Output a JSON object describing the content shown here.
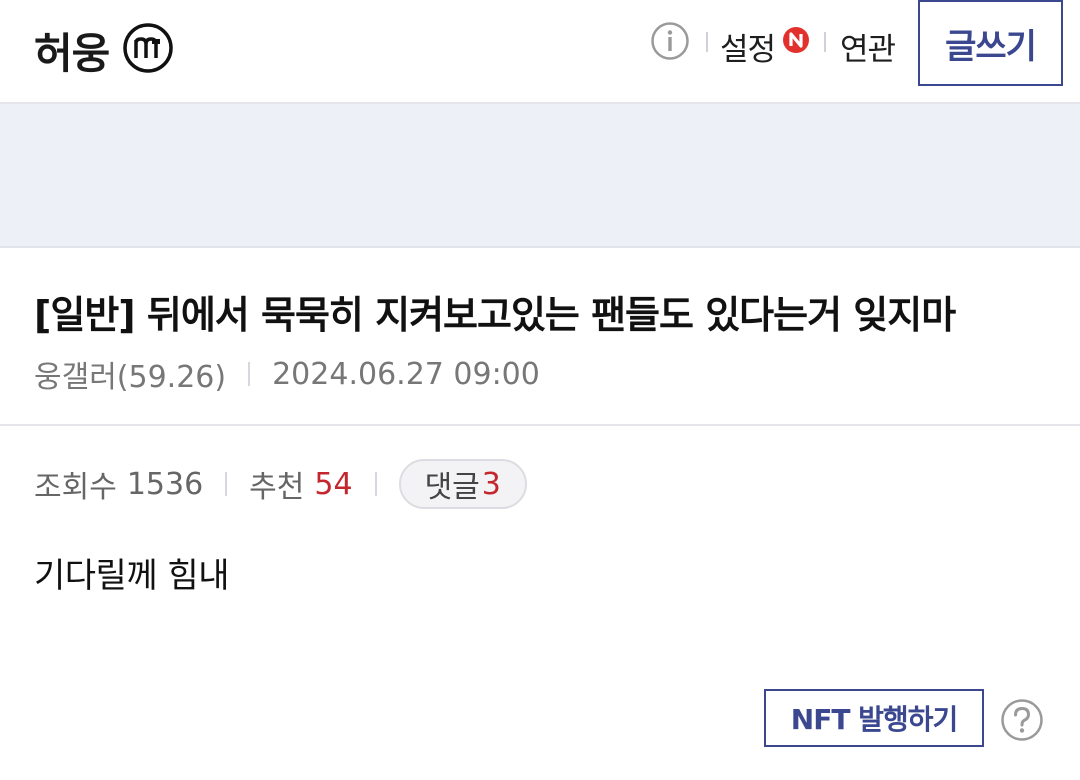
{
  "header": {
    "gallery_name": "허웅",
    "minor_badge_letter": "m",
    "info_icon": "info-icon",
    "settings_label": "설정",
    "new_badge_letter": "N",
    "related_label": "연관",
    "write_label": "글쓰기"
  },
  "post": {
    "title": "[일반] 뒤에서 묵묵히 지켜보고있는 팬들도 있다는거 잊지마",
    "author": "웅갤러(59.26)",
    "datetime": "2024.06.27 09:00",
    "views_label": "조회수",
    "views": "1536",
    "recommend_label": "추천",
    "recommend": "54",
    "comments_label": "댓글",
    "comments": "3",
    "body": "기다릴께 힘내"
  },
  "actions": {
    "nft_label": "NFT 발행하기",
    "help_icon": "question-icon"
  },
  "colors": {
    "accent": "#3b4890",
    "red": "#c4262e",
    "ad_band": "#edf0f6"
  }
}
